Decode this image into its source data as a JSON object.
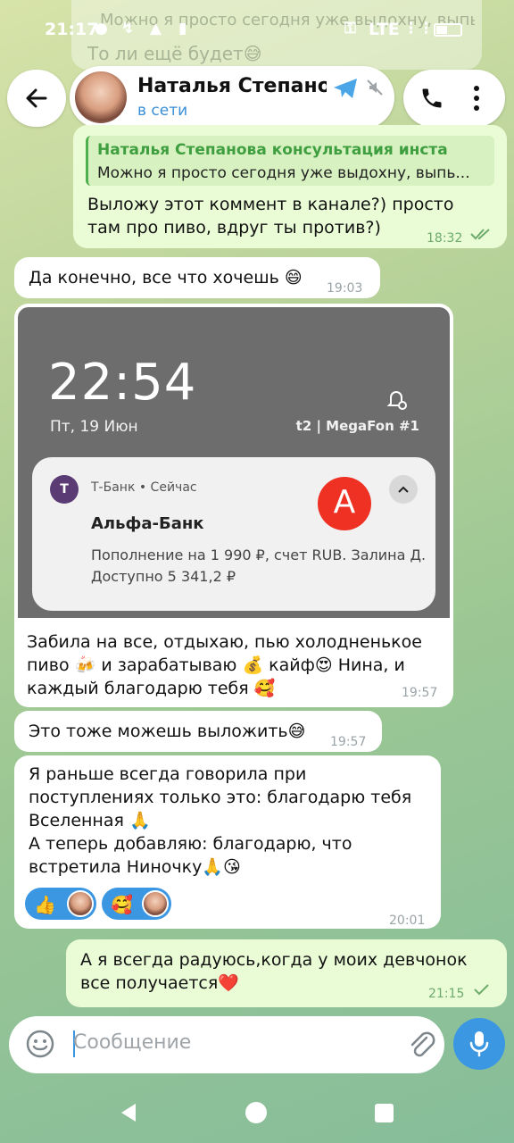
{
  "status_bar": {
    "time": "21:17",
    "network": "LTE"
  },
  "background_preview": {
    "line1": "Можно я просто сегодня уже выдохну, выпь...",
    "line2": "То ли ещё будет😅"
  },
  "header": {
    "contact_name": "Наталья Степанова",
    "contact_status": "в сети"
  },
  "messages": [
    {
      "id": "m1",
      "direction": "out",
      "reply_to_name": "Наталья Степанова консультация инста",
      "reply_to_text": "Можно я просто сегодня уже выдохну, выпь...",
      "lines": [
        "Выложу этот коммент в канале?) просто",
        "там про пиво, вдруг ты против?)"
      ],
      "time": "18:32",
      "read": true
    },
    {
      "id": "m2",
      "direction": "in",
      "text": "Да конечно, все что хочешь 😄",
      "time": "19:03"
    },
    {
      "id": "m3",
      "direction": "in",
      "screenshot": {
        "lock_time": "22:54",
        "lock_date": "Пт, 19 Июн",
        "carrier": "t2 | MegaFon #1",
        "notif_app": "Т-Банк • Сейчас",
        "notif_title": "Альфа-Банк",
        "notif_line1": "Пополнение на 1 990 ₽, счет RUB. Залина Д.",
        "notif_line2": "Доступно 5 341,2 ₽",
        "bank_logo_letter": "А"
      },
      "lines": [
        "Забила на все, отдыхаю, пью холодненькое",
        "пиво 🍻 и зарабатываю 💰 кайф😍 Нина, и",
        "каждый благодарю тебя 🥰"
      ],
      "time": "19:57"
    },
    {
      "id": "m4",
      "direction": "in",
      "text": "Это тоже можешь выложить😅",
      "time": "19:57"
    },
    {
      "id": "m5",
      "direction": "in",
      "lines": [
        "Я раньше всегда говорила при",
        "поступлениях только это: благодарю тебя",
        "Вселенная 🙏",
        "А теперь добавляю: благодарю, что",
        "встретила Ниночку🙏😘"
      ],
      "reactions": [
        "👍",
        "🥰"
      ],
      "time": "20:01"
    },
    {
      "id": "m6",
      "direction": "out",
      "lines": [
        "А я всегда радуюсь,когда у моих девчонок",
        "все получается❤️"
      ],
      "time": "21:15",
      "read": false
    }
  ],
  "composer": {
    "placeholder": "Сообщение"
  },
  "colors": {
    "accent": "#3c97e3",
    "outgoing_bubble": "#eafcd6",
    "incoming_bubble": "#ffffff",
    "check_green": "#6cab6c",
    "alfa_red": "#ef3124"
  }
}
